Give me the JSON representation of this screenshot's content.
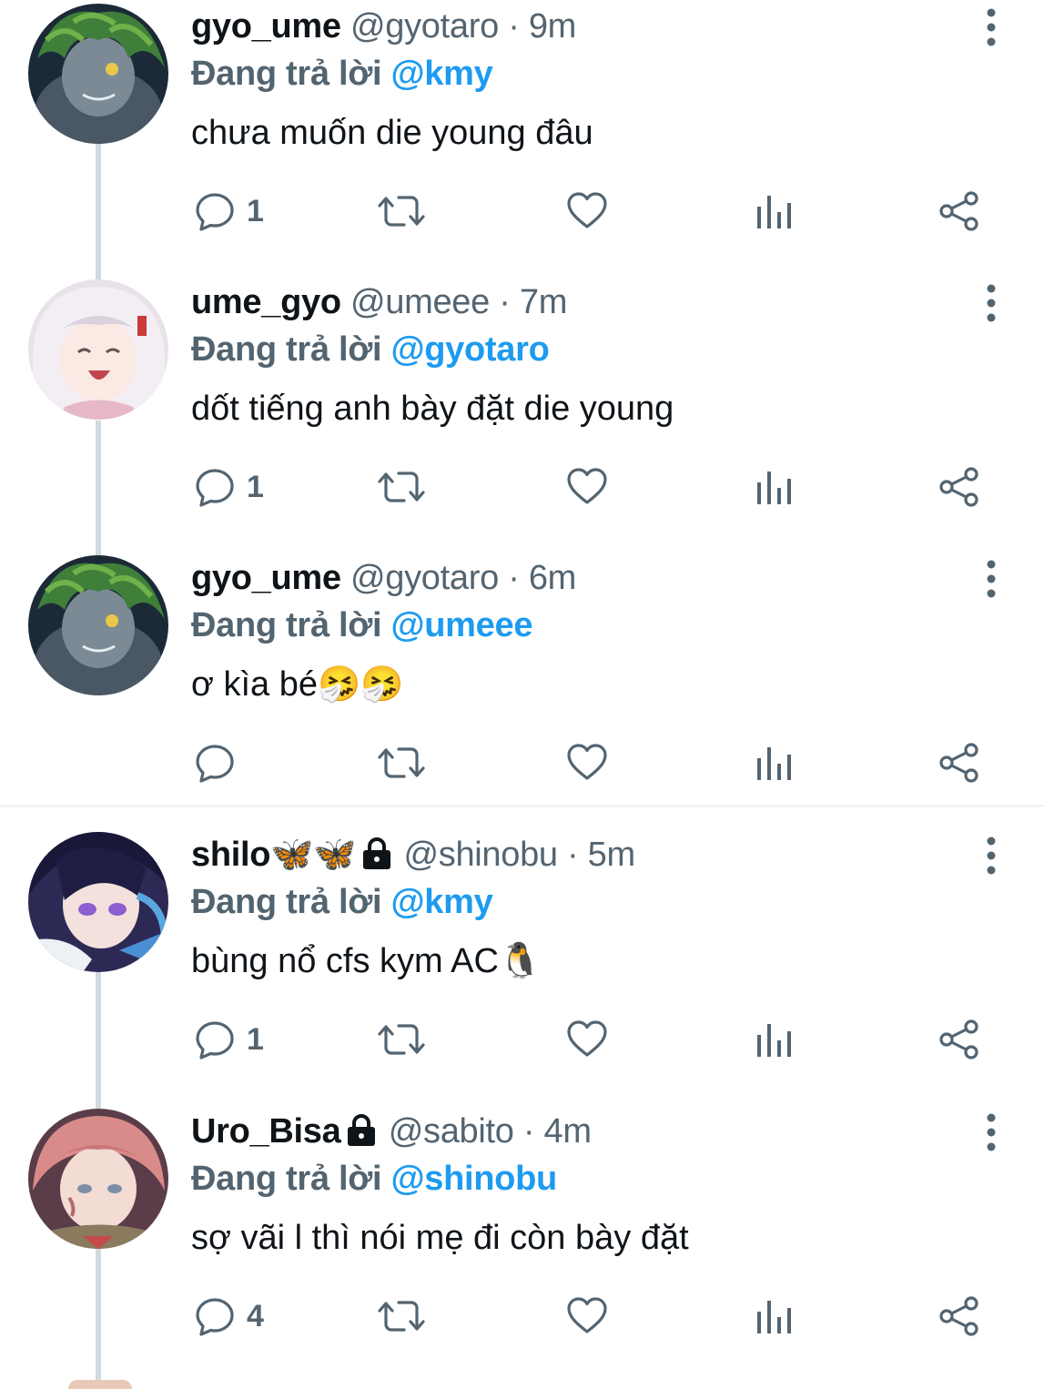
{
  "tweets": [
    {
      "name": "gyo_ume",
      "handle": "@gyotaro",
      "separator": "·",
      "time": "9m",
      "reply_prefix": "Đang trả lời",
      "reply_to": "@kmy",
      "text": "chưa muốn die young đâu",
      "reply_count": "1",
      "avatar_icon": "green-haired-demon-avatar"
    },
    {
      "name": "ume_gyo",
      "handle": "@umeee",
      "separator": "·",
      "time": "7m",
      "reply_prefix": "Đang trả lời",
      "reply_to": "@gyotaro",
      "text": "dốt tiếng anh bày đặt die young",
      "reply_count": "1",
      "avatar_icon": "white-haired-girl-avatar"
    },
    {
      "name": "gyo_ume",
      "handle": "@gyotaro",
      "separator": "·",
      "time": "6m",
      "reply_prefix": "Đang trả lời",
      "reply_to": "@umeee",
      "text": "ơ kìa bé🤧🤧",
      "reply_count": "",
      "avatar_icon": "green-haired-demon-avatar"
    },
    {
      "name": "shilo🦋🦋",
      "handle": "@shinobu",
      "separator": "·",
      "time": "5m",
      "reply_prefix": "Đang trả lời",
      "reply_to": "@kmy",
      "text": "bùng nổ cfs kym AC🐧",
      "reply_count": "1",
      "avatar_icon": "purple-eyed-girl-avatar"
    },
    {
      "name": "Uro_Bisa",
      "handle": "@sabito",
      "separator": "·",
      "time": "4m",
      "reply_prefix": "Đang trả lời",
      "reply_to": "@shinobu",
      "text": "sợ vãi l thì nói mẹ đi còn bày đặt",
      "reply_count": "4",
      "avatar_icon": "salmon-haired-boy-avatar"
    }
  ],
  "icons": {
    "reply": "reply-icon",
    "retweet": "retweet-icon",
    "like": "heart-icon",
    "views": "analytics-icon",
    "share": "share-icon",
    "more": "more-options-icon",
    "protected": "lock-icon"
  },
  "colors": {
    "accent": "#1d9bf0",
    "secondary_text": "#536471",
    "thread_line": "#cfd9de"
  }
}
